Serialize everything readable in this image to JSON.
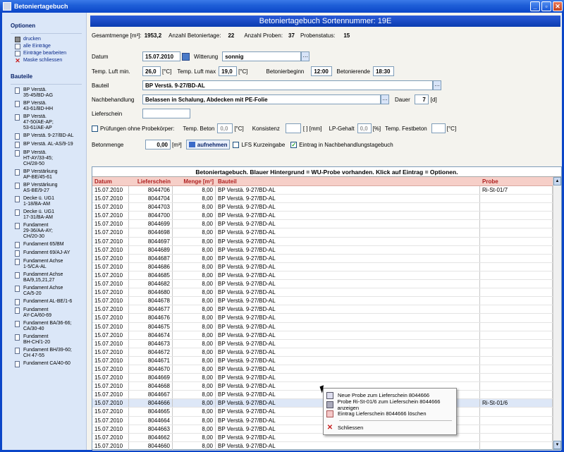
{
  "window": {
    "title": "Betoniertagebuch"
  },
  "sidebar": {
    "options_head": "Optionen",
    "options": [
      {
        "label": "drucken",
        "icon": "printer-icon"
      },
      {
        "label": "alle Einträge",
        "icon": "document-icon"
      },
      {
        "label": "Einträge bearbeiten",
        "icon": "document-icon"
      },
      {
        "label": "Maske schliessen",
        "icon": "close-icon"
      }
    ],
    "parts_head": "Bauteile",
    "parts": [
      "BP Verstä.\n35-45/BD-AG",
      "BP Verstä.\n43-61/BD-HH",
      "BP Verstä.\n47-50/AE-AP;\n53-61/AE-AP",
      "BP Verstä. 9-27/BD-AL",
      "BP Verstä. AL-AS/9-19",
      "BP Verstä.\nHT-AY/33-45;\nCH/28-50",
      "BP Verstärkung\nAP-BE/45-61",
      "BP Verstärkung\nAS-BE/9-27",
      "Decke ü. UG1\n1-18/BA-AM",
      "Decke ü. UG1\n17-31/BA-AM",
      "Fundament\n29-36/AA-AY;\nCH/20-30",
      "Fundament 65/BM",
      "Fundament 69/AJ-AY",
      "Fundament Achse\n1-5/CA-AL",
      "Fundament Achse\nBA/9,15,21,27",
      "Fundament Achse\nCA/5-20",
      "Fundament AL-BE/1-6",
      "Fundament\nAY-CA/60-69",
      "Fundament BA/36-66;\nCA/30-40",
      "Fundament\nBH-CH/1-20",
      "Fundament BH/39-60;\nCH 47-55",
      "Fundament CA/40-60"
    ]
  },
  "header": {
    "title": "Betoniertagebuch Sortennummer: 19E"
  },
  "summary": {
    "gesamtmenge_label": "Gesamtmenge [m³]:",
    "gesamtmenge": "1953,2",
    "tage_label": "Anzahl Betoniertage:",
    "tage": "22",
    "proben_label": "Anzahl Proben:",
    "proben": "37",
    "status_label": "Probenstatus:",
    "status": "15"
  },
  "form": {
    "datum_label": "Datum",
    "datum": "15.07.2010",
    "witterung_label": "Witterung",
    "witterung": "sonnig",
    "luft_min_label": "Temp. Luft min.",
    "luft_min": "26,0",
    "unit_c": "[°C]",
    "luft_max_label": "Temp. Luft max",
    "luft_max": "19,0",
    "beginn_label": "Betonierbeginn",
    "beginn": "12:00",
    "ende_label": "Betonierende",
    "ende": "18:30",
    "bauteil_label": "Bauteil",
    "bauteil": "BP Verstä. 9-27/BD-AL",
    "nach_label": "Nachbehandlung",
    "nach": "Belassen in Schalung, Abdecken mit PE-Folie",
    "dauer_label": "Dauer",
    "dauer": "7",
    "dauer_unit": "[d]",
    "liefer_label": "Lieferschein",
    "liefer": "",
    "pruef_label": "Prüfungen ohne Probekörper:",
    "temp_beton_label": "Temp. Beton",
    "temp_beton": "0,0",
    "konsistenz_label": "Konsistenz",
    "konsistenz": "",
    "konsistenz_unit": "[ ] [mm]",
    "lp_label": "LP-Gehalt",
    "lp": "0,0",
    "lp_unit": "[%]",
    "festbeton_label": "Temp. Festbeton",
    "festbeton": "",
    "menge_label": "Betonmenge",
    "menge": "0,00",
    "menge_unit": "[m³]",
    "aufnehmen": "aufnehmen",
    "lfs_label": "LFS Kurzeingabe",
    "eintrag_label": "Eintrag in Nachbehandlungstagebuch"
  },
  "table": {
    "caption": "Betoniertagebuch. Blauer Hintergrund = WU-Probe vorhanden. Klick auf Eintrag = Optionen.",
    "columns": [
      "Datum",
      "Lieferschein",
      "Menge [m³]",
      "Bauteil",
      "Probe"
    ],
    "rows": [
      [
        "15.07.2010",
        "8044706",
        "8,00",
        "BP Verstä. 9-27/BD-AL",
        "Ri-St-01/7"
      ],
      [
        "15.07.2010",
        "8044704",
        "8,00",
        "BP Verstä. 9-27/BD-AL",
        ""
      ],
      [
        "15.07.2010",
        "8044703",
        "8,00",
        "BP Verstä. 9-27/BD-AL",
        ""
      ],
      [
        "15.07.2010",
        "8044700",
        "8,00",
        "BP Verstä. 9-27/BD-AL",
        ""
      ],
      [
        "15.07.2010",
        "8044699",
        "8,00",
        "BP Verstä. 9-27/BD-AL",
        ""
      ],
      [
        "15.07.2010",
        "8044698",
        "8,00",
        "BP Verstä. 9-27/BD-AL",
        ""
      ],
      [
        "15.07.2010",
        "8044697",
        "8,00",
        "BP Verstä. 9-27/BD-AL",
        ""
      ],
      [
        "15.07.2010",
        "8044689",
        "8,00",
        "BP Verstä. 9-27/BD-AL",
        ""
      ],
      [
        "15.07.2010",
        "8044687",
        "8,00",
        "BP Verstä. 9-27/BD-AL",
        ""
      ],
      [
        "15.07.2010",
        "8044686",
        "8,00",
        "BP Verstä. 9-27/BD-AL",
        ""
      ],
      [
        "15.07.2010",
        "8044685",
        "8,00",
        "BP Verstä. 9-27/BD-AL",
        ""
      ],
      [
        "15.07.2010",
        "8044682",
        "8,00",
        "BP Verstä. 9-27/BD-AL",
        ""
      ],
      [
        "15.07.2010",
        "8044680",
        "8,00",
        "BP Verstä. 9-27/BD-AL",
        ""
      ],
      [
        "15.07.2010",
        "8044678",
        "8,00",
        "BP Verstä. 9-27/BD-AL",
        ""
      ],
      [
        "15.07.2010",
        "8044677",
        "8,00",
        "BP Verstä. 9-27/BD-AL",
        ""
      ],
      [
        "15.07.2010",
        "8044676",
        "8,00",
        "BP Verstä. 9-27/BD-AL",
        ""
      ],
      [
        "15.07.2010",
        "8044675",
        "8,00",
        "BP Verstä. 9-27/BD-AL",
        ""
      ],
      [
        "15.07.2010",
        "8044674",
        "8,00",
        "BP Verstä. 9-27/BD-AL",
        ""
      ],
      [
        "15.07.2010",
        "8044673",
        "8,00",
        "BP Verstä. 9-27/BD-AL",
        ""
      ],
      [
        "15.07.2010",
        "8044672",
        "8,00",
        "BP Verstä. 9-27/BD-AL",
        ""
      ],
      [
        "15.07.2010",
        "8044671",
        "8,00",
        "BP Verstä. 9-27/BD-AL",
        ""
      ],
      [
        "15.07.2010",
        "8044670",
        "8,00",
        "BP Verstä. 9-27/BD-AL",
        ""
      ],
      [
        "15.07.2010",
        "8044669",
        "8,00",
        "BP Verstä. 9-27/BD-AL",
        ""
      ],
      [
        "15.07.2010",
        "8044668",
        "8,00",
        "BP Verstä. 9-27/BD-AL",
        ""
      ],
      [
        "15.07.2010",
        "8044667",
        "8,00",
        "BP Verstä. 9-27/BD-AL",
        ""
      ],
      [
        "15.07.2010",
        "8044666",
        "8,00",
        "BP Verstä. 9-27/BD-AL",
        "Ri-St-01/6"
      ],
      [
        "15.07.2010",
        "8044665",
        "8,00",
        "BP Verstä. 9-27/BD-AL",
        ""
      ],
      [
        "15.07.2010",
        "8044664",
        "8,00",
        "BP Verstä. 9-27/BD-AL",
        ""
      ],
      [
        "15.07.2010",
        "8044663",
        "8,00",
        "BP Verstä. 9-27/BD-AL",
        ""
      ],
      [
        "15.07.2010",
        "8044662",
        "8,00",
        "BP Verstä. 9-27/BD-AL",
        ""
      ],
      [
        "15.07.2010",
        "8044660",
        "8,00",
        "BP Verstä. 9-27/BD-AL",
        ""
      ]
    ],
    "selected_row": 25
  },
  "context_menu": {
    "items": [
      {
        "label": "Neue Probe zum Lieferschein 8044666",
        "icon": "new-sample-icon"
      },
      {
        "label": "Probe Ri-St-01/6 zum Lieferschein 8044666 anzeigen",
        "icon": "show-sample-icon"
      },
      {
        "label": "Eintrag Lieferschein 8044666 löschen",
        "icon": "delete-entry-icon"
      }
    ],
    "close_label": "Schliessen"
  }
}
